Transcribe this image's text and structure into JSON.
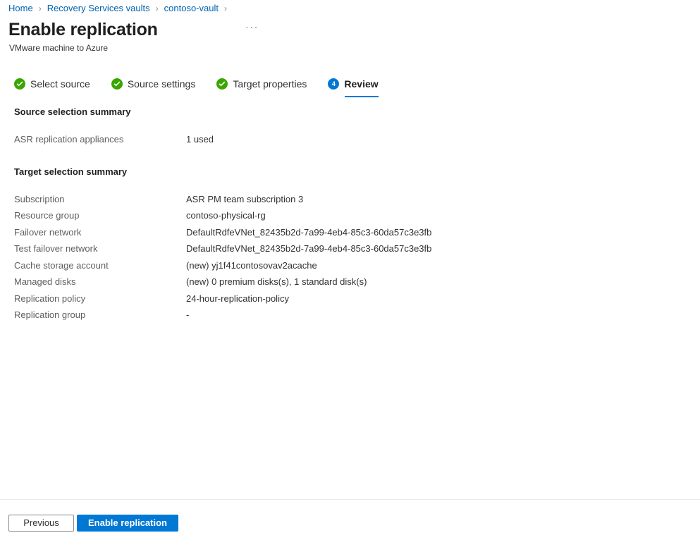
{
  "breadcrumb": {
    "separator": "›",
    "items": [
      {
        "label": "Home"
      },
      {
        "label": "Recovery Services vaults"
      },
      {
        "label": "contoso-vault"
      }
    ],
    "trailing_separator": "›"
  },
  "header": {
    "title": "Enable replication",
    "subtitle": "VMware machine to Azure",
    "more_menu": "···"
  },
  "wizard": {
    "tabs": [
      {
        "label": "Select source",
        "state": "done",
        "badge": "✓"
      },
      {
        "label": "Source settings",
        "state": "done",
        "badge": "✓"
      },
      {
        "label": "Target properties",
        "state": "done",
        "badge": "✓"
      },
      {
        "label": "Review",
        "state": "current",
        "badge": "4"
      }
    ]
  },
  "main": {
    "sections": [
      {
        "heading": "Source selection summary",
        "rows": [
          {
            "key": "ASR replication appliances",
            "value": "1 used"
          }
        ]
      },
      {
        "heading": "Target selection summary",
        "rows": [
          {
            "key": "Subscription",
            "value": "ASR PM team subscription 3"
          },
          {
            "key": "Resource group",
            "value": "contoso-physical-rg"
          },
          {
            "key": "Failover network",
            "value": "DefaultRdfeVNet_82435b2d-7a99-4eb4-85c3-60da57c3e3fb"
          },
          {
            "key": "Test failover network",
            "value": "DefaultRdfeVNet_82435b2d-7a99-4eb4-85c3-60da57c3e3fb"
          },
          {
            "key": "Cache storage account",
            "value": "(new) yj1f41contosovav2acache"
          },
          {
            "key": "Managed disks",
            "value": "(new) 0 premium disks(s), 1 standard disk(s)"
          },
          {
            "key": "Replication policy",
            "value": "24-hour-replication-policy"
          },
          {
            "key": "Replication group",
            "value": "-"
          }
        ]
      }
    ]
  },
  "footer": {
    "previous_label": "Previous",
    "submit_label": "Enable replication"
  },
  "colors": {
    "link": "#0063b1",
    "accent": "#0078d4",
    "success": "#3aa600",
    "label_text": "#605e5c",
    "value_text": "#323130",
    "divider": "#edebe9"
  }
}
